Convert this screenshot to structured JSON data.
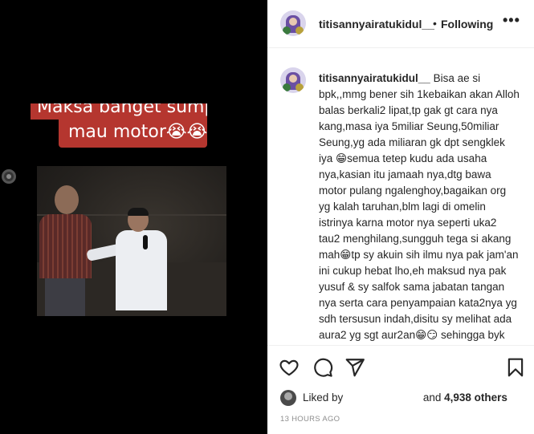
{
  "media": {
    "caption_top": "Maksa banget sumpah",
    "caption_bottom": "mau motor😭😭"
  },
  "header": {
    "username": "titisannyairatukidul__",
    "separator": "•",
    "follow_status": "Following",
    "more_label": "•••"
  },
  "comment": {
    "username": "titisannyairatukidul__",
    "text": "Bisa ae si bpk,,mmg bener sih 1kebaikan akan Alloh balas berkali2 lipat,tp gak gt cara nya kang,masa iya 5miliar Seung,50miliar Seung,yg ada miliaran gk dpt sengklek iya 😁semua tetep kudu ada usaha nya,kasian itu jamaah nya,dtg bawa motor pulang ngalenghoy,bagaikan org yg kalah taruhan,blm lagi di omelin istrinya karna motor nya seperti uka2 tau2 menghilang,sungguh tega si akang mah😁tp sy akuin sih ilmu nya pak jam'an ini cukup hebat lho,eh maksud nya pak yusuf & sy salfok sama jabatan tangan nya serta cara penyampaian kata2nya yg sdh tersusun indah,disitu sy melihat ada aura2 yg sgt aur2an😁😏 sehingga byk org yg tergiur & dgn terpaksa bersedekah walau pd akhirnya"
  },
  "actions": {
    "icons": [
      "heart-icon",
      "comment-icon",
      "share-icon",
      "bookmark-icon"
    ]
  },
  "likes": {
    "prefix": "Liked by",
    "joiner": "and",
    "count_text": "4,938 others"
  },
  "timestamp": "13 HOURS AGO",
  "colors": {
    "caption_bg": "#b5362f",
    "text": "#262626",
    "muted": "#8e8e8e"
  }
}
